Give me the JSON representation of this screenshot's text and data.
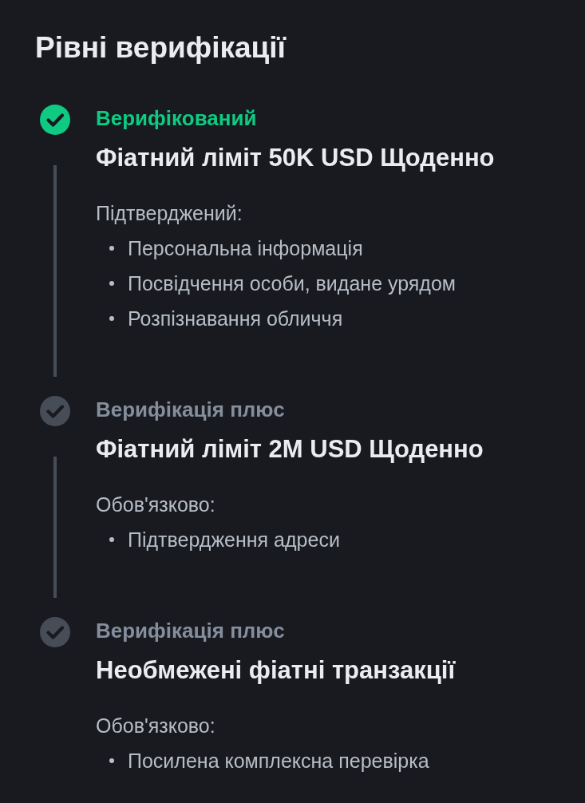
{
  "title": "Рівні верифікації",
  "levels": [
    {
      "status": "Верифікований",
      "completed": true,
      "limit": "Фіатний ліміт 50K USD Щоденно",
      "requirement_label": "Підтверджений:",
      "requirements": [
        "Персональна інформація",
        "Посвідчення особи, видане урядом",
        "Розпізнавання обличчя"
      ]
    },
    {
      "status": "Верифікація плюс",
      "completed": false,
      "limit": "Фіатний ліміт 2M USD Щоденно",
      "requirement_label": "Обов'язково:",
      "requirements": [
        "Підтвердження адреси"
      ]
    },
    {
      "status": "Верифікація плюс",
      "completed": false,
      "limit": "Необмежені фіатні транзакції",
      "requirement_label": "Обов'язково:",
      "requirements": [
        "Посилена комплексна перевірка"
      ]
    }
  ]
}
